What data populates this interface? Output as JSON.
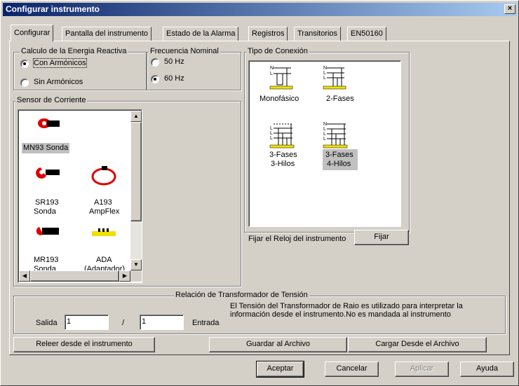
{
  "window": {
    "title": "Configurar instrumento",
    "close": "×"
  },
  "tabs": [
    {
      "label": "Configurar",
      "active": true
    },
    {
      "label": "Pantalla del instrumento"
    },
    {
      "label": "Estado de la Alarma"
    },
    {
      "label": "Registros"
    },
    {
      "label": "Transitorios"
    },
    {
      "label": "EN50160"
    }
  ],
  "reactive_energy": {
    "legend": "Calculo de  la Energia Reactiva",
    "options": [
      {
        "label": "Con Armónicos",
        "selected": true
      },
      {
        "label": "Sin Armónicos",
        "selected": false
      }
    ]
  },
  "nominal_frequency": {
    "legend": "Frecuencia Nominal",
    "options": [
      {
        "label": "50 Hz",
        "selected": false
      },
      {
        "label": "60 Hz",
        "selected": true
      }
    ]
  },
  "current_sensor": {
    "legend": "Sensor de  Corriente",
    "items": [
      {
        "icon": "mn93-clamp-icon",
        "line1": "MN93 Sonda",
        "line2": "",
        "selected": true
      },
      {
        "icon": "sr193-clamp-icon",
        "line1": "SR193",
        "line2": "Sonda"
      },
      {
        "icon": "ampflex-icon",
        "line1": "A193",
        "line2": "AmpFlex"
      },
      {
        "icon": "mr193-clamp-icon",
        "line1": "MR193",
        "line2": "Sonda"
      },
      {
        "icon": "adapter-icon",
        "line1": "ADA",
        "line2": "(Adaptador)"
      }
    ]
  },
  "connection_type": {
    "legend": "Tipo de Conexión",
    "items": [
      {
        "icon": "single-phase-icon",
        "line1": "Monofásico",
        "line2": ""
      },
      {
        "icon": "two-phase-icon",
        "line1": "2-Fases",
        "line2": ""
      },
      {
        "icon": "three-phase-three-wire-icon",
        "line1": "3-Fases",
        "line2": "3-Hilos"
      },
      {
        "icon": "three-phase-four-wire-icon",
        "line1": "3-Fases",
        "line2": "4-Hilos",
        "selected": true
      }
    ]
  },
  "clock": {
    "label": "Fijar el Reloj del instrumento",
    "button": "Fijar"
  },
  "voltage_transformer": {
    "legend": "Relación de Transformador de Tensión",
    "output_label": "Salida",
    "output_value": "1",
    "separator": "/",
    "input_value": "1",
    "input_label": "Entrada",
    "note": "El Tensión del Transformador de Raio es utilizado para interpretar la información desde el instrumento.No es mandada al instrumento"
  },
  "actions": {
    "reload": "Releer desde el instrumento",
    "save": "Guardar al Archivo",
    "load": "Cargar Desde el Archivo"
  },
  "footer": {
    "accept": "Aceptar",
    "cancel": "Cancelar",
    "apply": "Aplicar",
    "help": "Ayuda"
  },
  "colors": {
    "title_start": "#0a246a",
    "title_end": "#a6caf0",
    "face": "#d4d0c8",
    "icon_red": "#e00000",
    "icon_yellow": "#f0e000"
  }
}
